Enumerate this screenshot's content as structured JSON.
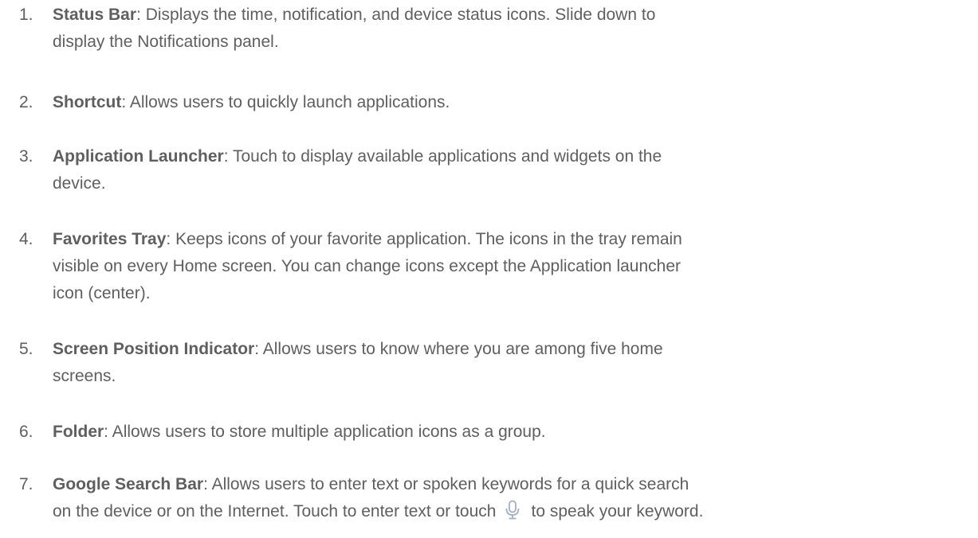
{
  "items": [
    {
      "num": "1.",
      "term": "Status Bar",
      "text": ": Displays the time, notification, and device status icons. Slide down to",
      "text2": "display the Notifications panel."
    },
    {
      "num": "2.",
      "term": "Shortcut",
      "text": ": Allows users to quickly launch applications."
    },
    {
      "num": "3.",
      "term": "Application Launcher",
      "text": ": Touch to display available applications and widgets on the",
      "text2": "device."
    },
    {
      "num": "4.",
      "term": "Favorites Tray",
      "text": ": Keeps icons of your favorite application. The icons in the tray remain",
      "text2": "visible on every Home screen. You can change icons except the Application launcher",
      "text3": "icon (center)."
    },
    {
      "num": "5.",
      "term": "Screen Position Indicator",
      "text": ": Allows users to know where you are among five home",
      "text2": "screens."
    },
    {
      "num": "6.",
      "term": "Folder",
      "text": ": Allows users to store multiple application icons as a group."
    },
    {
      "num": "7.",
      "term": "Google Search Bar",
      "text": ": Allows users to enter text or spoken keywords for a quick search",
      "text2a": "on the device or on the Internet. Touch to enter text or touch",
      "text2b": "to speak your keyword."
    }
  ],
  "icons": {
    "mic": "microphone-icon"
  },
  "colors": {
    "text": "#5f5f5f",
    "icon": "#9fb0c8"
  }
}
